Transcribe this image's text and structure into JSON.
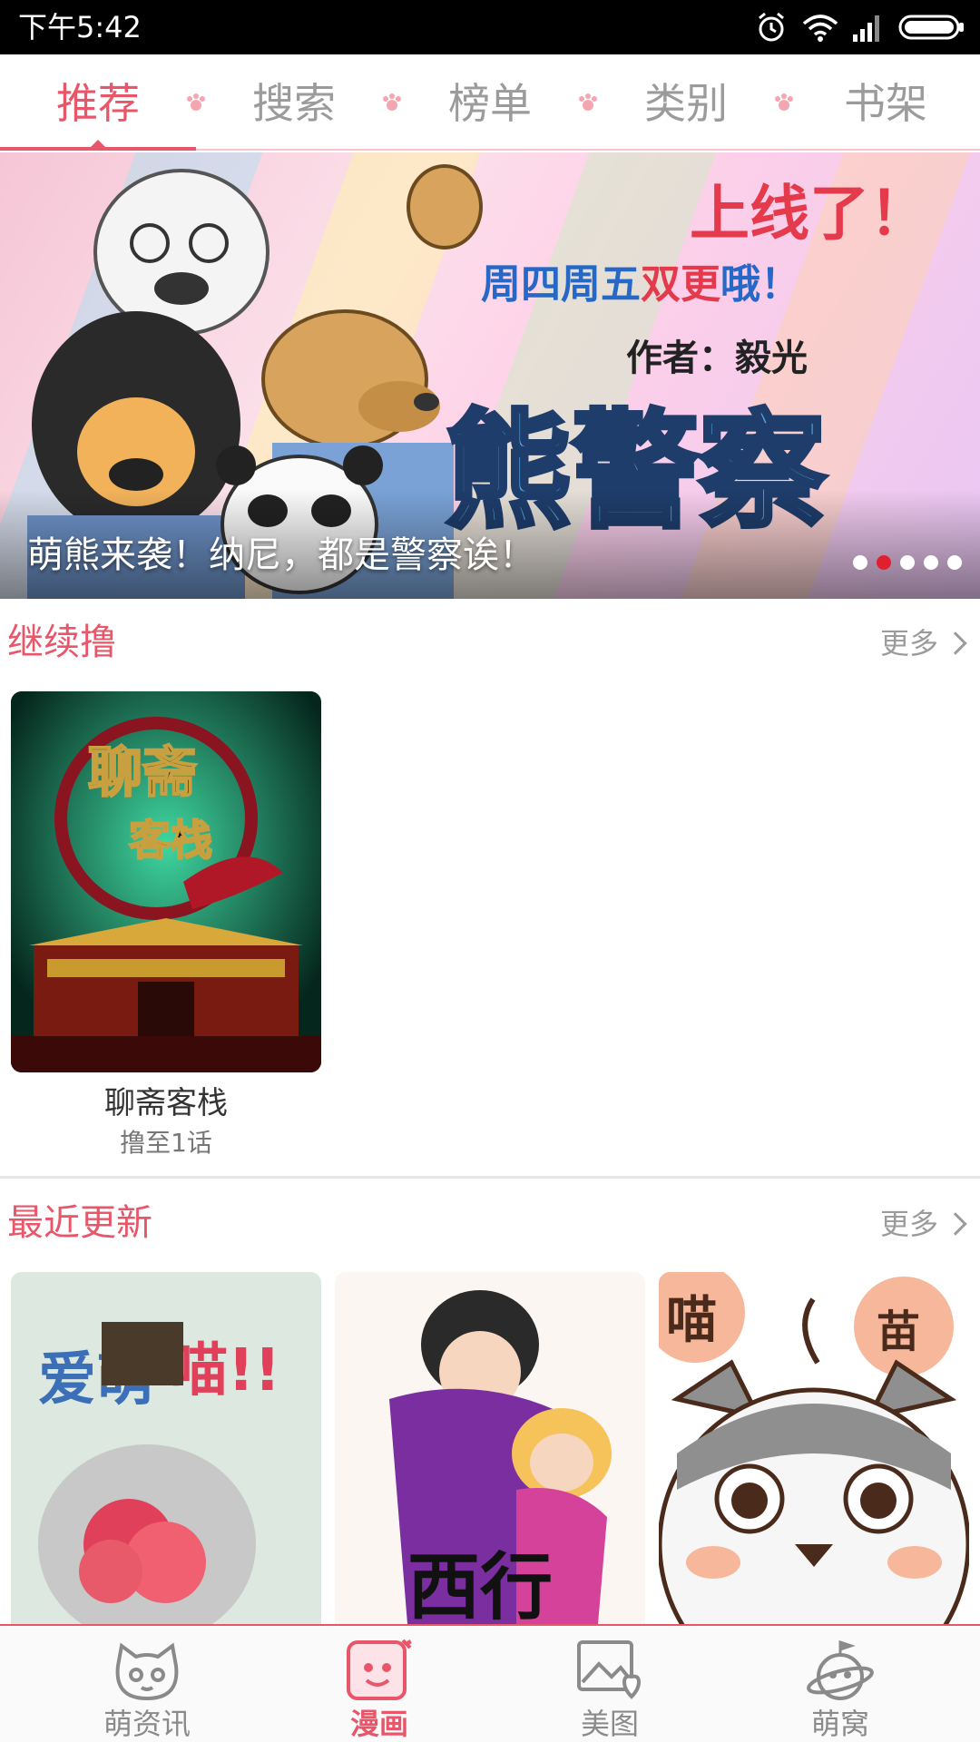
{
  "status_bar": {
    "time": "下午5:42",
    "icons": [
      "alarm-icon",
      "wifi-icon",
      "signal-icon",
      "battery-icon"
    ]
  },
  "top_tabs": [
    {
      "label": "推荐",
      "active": true
    },
    {
      "label": "搜索",
      "active": false
    },
    {
      "label": "榜单",
      "active": false
    },
    {
      "label": "类别",
      "active": false
    },
    {
      "label": "书架",
      "active": false
    }
  ],
  "banner": {
    "caption": "萌熊来袭！纳尼，都是警察诶！",
    "art_text": {
      "headline": "上线了！",
      "schedule": "周四周五双更哦！",
      "author": "作者：毅光",
      "series": "熊警察"
    },
    "slides_total": 5,
    "active_slide": 2
  },
  "continue_section": {
    "title": "继续撸",
    "more": "更多",
    "items": [
      {
        "title": "聊斋客栈",
        "progress": "撸至1话",
        "cover_art_text": "聊斋客栈"
      }
    ]
  },
  "recent_section": {
    "title": "最近更新",
    "more": "更多",
    "items": [
      {
        "cover_art_text": "爱萌喵!!"
      },
      {
        "cover_art_text": "西行"
      },
      {
        "cover_art_text": "喵苗"
      }
    ]
  },
  "bottom_nav": [
    {
      "label": "萌资讯",
      "icon": "cat-face-icon",
      "active": false
    },
    {
      "label": "漫画",
      "icon": "comic-face-icon",
      "active": true
    },
    {
      "label": "美图",
      "icon": "picture-heart-icon",
      "active": false
    },
    {
      "label": "萌窝",
      "icon": "planet-icon",
      "active": false
    }
  ],
  "colors": {
    "accent": "#e8566a",
    "inactive": "#9b9b9b",
    "status_bar": "#000000"
  }
}
